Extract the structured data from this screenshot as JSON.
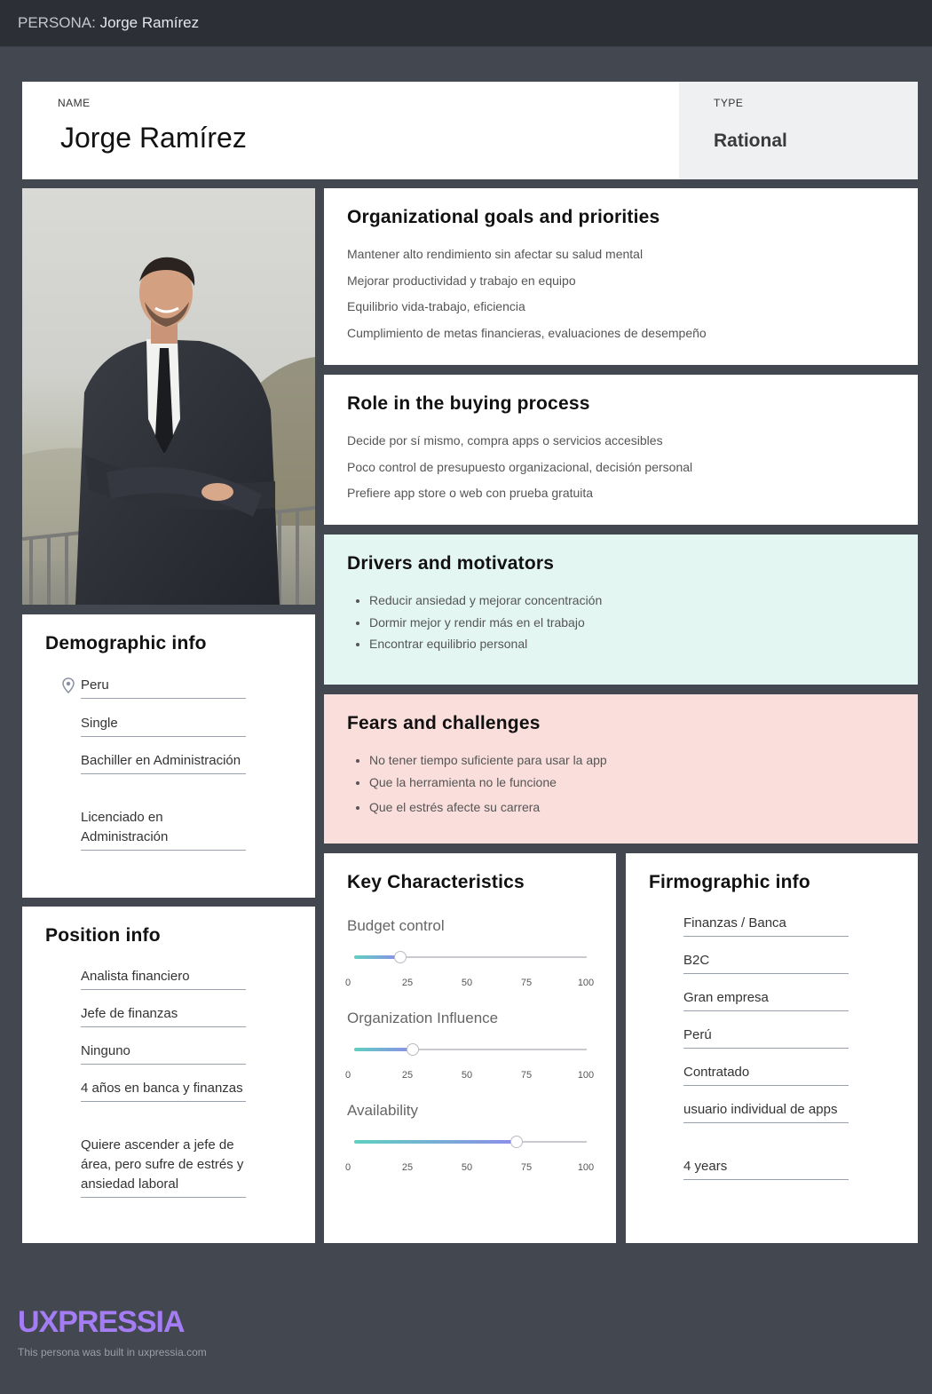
{
  "header": {
    "label": "PERSONA:",
    "name": "Jorge Ramírez"
  },
  "name_card": {
    "label": "NAME",
    "value": "Jorge Ramírez"
  },
  "type_card": {
    "label": "TYPE",
    "value": "Rational"
  },
  "goals": {
    "title": "Organizational goals and priorities",
    "items": [
      "Mantener alto rendimiento sin afectar su salud mental",
      "Mejorar productividad y trabajo en equipo",
      "Equilibrio vida-trabajo, eficiencia",
      "Cumplimiento de metas financieras, evaluaciones de desempeño"
    ]
  },
  "role": {
    "title": "Role in the buying process",
    "items": [
      "Decide por sí mismo, compra apps o servicios accesibles",
      "Poco control de presupuesto organizacional, decisión personal",
      "Prefiere app store o web con prueba gratuita"
    ]
  },
  "drivers": {
    "title": "Drivers and motivators",
    "items": [
      "Reducir ansiedad y mejorar concentración",
      "Dormir mejor y rendir más en el trabajo",
      "Encontrar equilibrio personal"
    ]
  },
  "fears": {
    "title": "Fears and challenges",
    "items": [
      "No tener tiempo suficiente para usar la app",
      "Que la herramienta no le funcione",
      "Que el estrés afecte su carrera"
    ]
  },
  "demographic": {
    "title": "Demographic info",
    "location": "Peru",
    "items": [
      "Single",
      "Bachiller en Administración",
      "Licenciado en Administración"
    ]
  },
  "position": {
    "title": "Position info",
    "items": [
      "Analista financiero",
      "Jefe de finanzas",
      "Ninguno",
      "4 años en banca y finanzas",
      "Quiere ascender a jefe de área, pero sufre de estrés y ansiedad laboral"
    ]
  },
  "characteristics": {
    "title": "Key Characteristics",
    "ticks": [
      "0",
      "25",
      "50",
      "75",
      "100"
    ],
    "sliders": [
      {
        "label": "Budget control",
        "value": 20
      },
      {
        "label": "Organization Influence",
        "value": 25
      },
      {
        "label": "Availability",
        "value": 70
      }
    ]
  },
  "firmographic": {
    "title": "Firmographic info",
    "items": [
      "Finanzas / Banca",
      "B2C",
      "Gran empresa",
      "Perú",
      "Contratado",
      "usuario individual de apps",
      "4 years"
    ]
  },
  "colors": {
    "drivers_bg": "#e4f6f2",
    "fears_bg": "#f9dedb",
    "brand": "#a47cf3"
  },
  "footer": {
    "logo": "UXPRESSIA",
    "note": "This persona was built in uxpressia.com"
  }
}
